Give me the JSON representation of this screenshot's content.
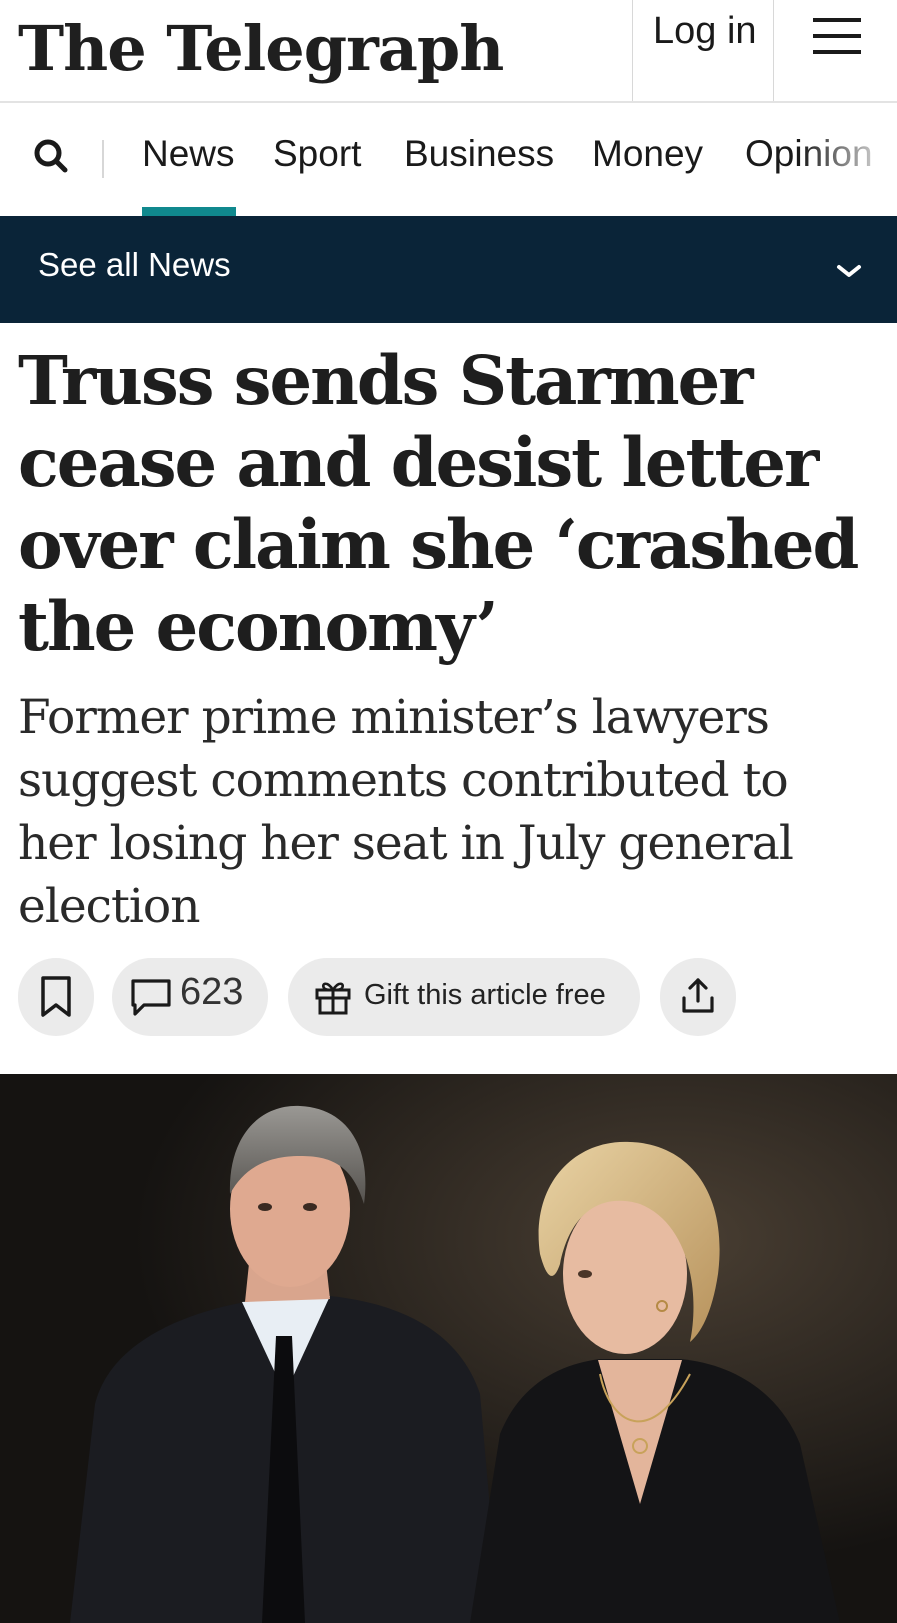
{
  "header": {
    "logo_text": "The Telegraph",
    "login_label": "Log in",
    "menu_icon": "hamburger-menu-icon"
  },
  "nav": {
    "search_icon": "search-icon",
    "items": [
      {
        "label": "News",
        "active": true
      },
      {
        "label": "Sport"
      },
      {
        "label": "Business"
      },
      {
        "label": "Money"
      },
      {
        "label": "Opinion"
      }
    ],
    "active_color": "#10898e"
  },
  "section_bar": {
    "label": "See all News",
    "icon": "chevron-down-icon",
    "background": "#0a2438"
  },
  "article": {
    "headline": "Truss sends Starmer cease and desist letter over claim she ‘crashed the economy’",
    "standfirst": "Former prime minister’s lawyers suggest comments contributed to her losing her seat in July general election",
    "actions": {
      "save_icon": "bookmark-icon",
      "comments_icon": "comment-icon",
      "comment_count": "623",
      "gift_icon": "gift-icon",
      "gift_label": "Gift this article free",
      "share_icon": "share-icon"
    }
  },
  "hero_image": {
    "description_icon": "photo"
  }
}
